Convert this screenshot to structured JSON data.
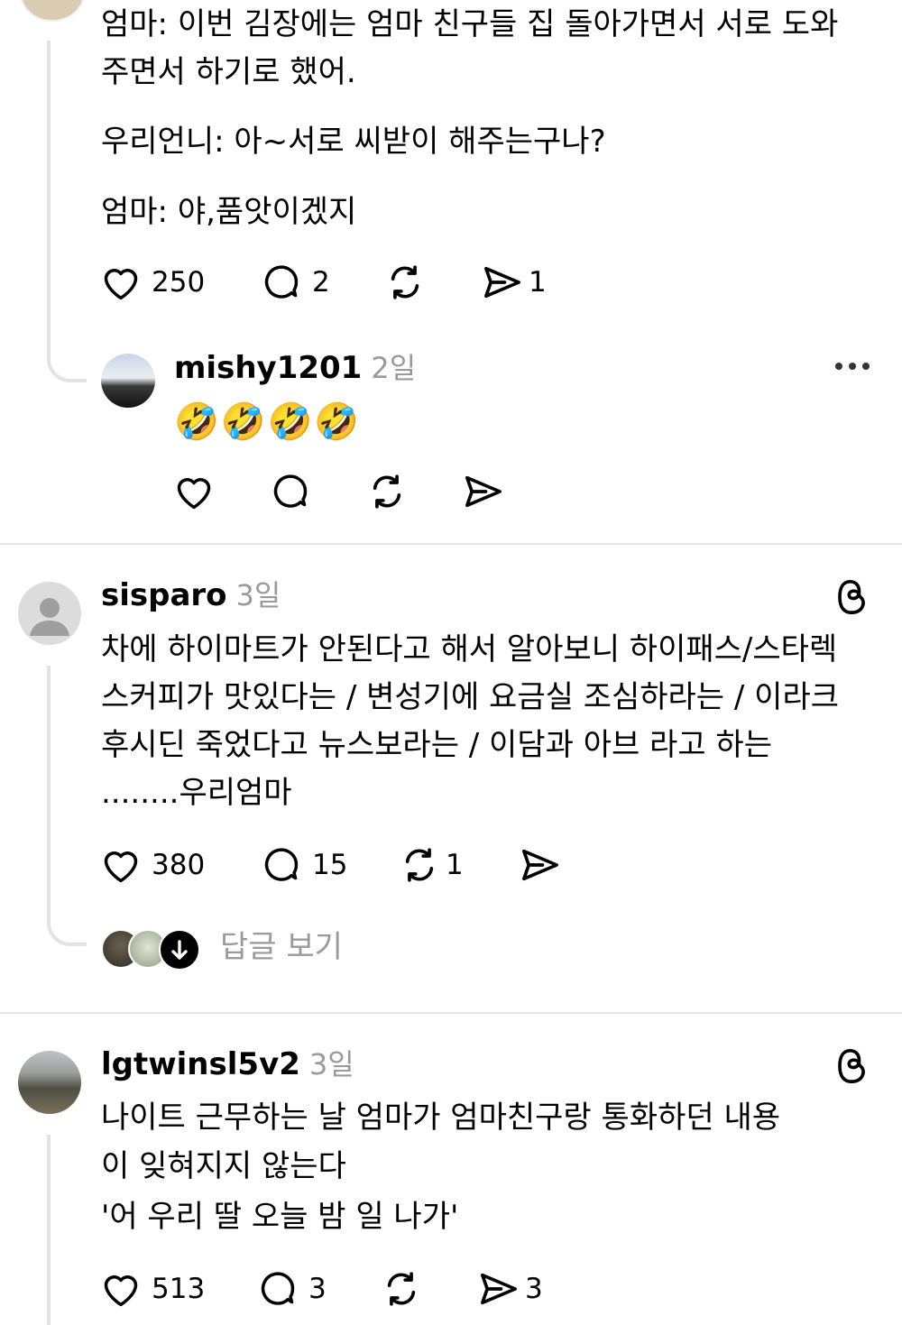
{
  "post1": {
    "lines": [
      "엄마: 이번 김장에는 엄마 친구들 집 돌아가면서 서로 도와",
      "주면서 하기로 했어.",
      "우리언니: 아~서로 씨받이 해주는구나?",
      "엄마: 야,품앗이겠지"
    ],
    "likes": "250",
    "replies": "2",
    "shares": "1"
  },
  "reply1": {
    "username": "mishy1201",
    "time": "2일",
    "emoji": "🤣🤣🤣🤣"
  },
  "post2": {
    "username": "sisparo",
    "time": "3일",
    "lines": [
      "차에 하이마트가 안된다고 해서 알아보니 하이패스/스타렉",
      "스커피가 맛있다는 / 변성기에 요금실 조심하라는 / 이라크",
      "후시딘 죽었다고 뉴스보라는 / 이담과 아브 라고 하는",
      "........우리엄마"
    ],
    "likes": "380",
    "replies": "15",
    "reposts": "1",
    "view_replies": "답글 보기"
  },
  "post3": {
    "username": "lgtwinsl5v2",
    "time": "3일",
    "lines": [
      "나이트 근무하는 날 엄마가 엄마친구랑 통화하던 내용",
      "이 잊혀지지 않는다",
      "'어 우리 딸 오늘 밤 일 나가'"
    ],
    "likes": "513",
    "replies": "3",
    "shares": "3"
  },
  "colors": {
    "divider": "#e6e6e6",
    "muted": "#9a9a9a",
    "thread_line": "#e3e3e3"
  }
}
